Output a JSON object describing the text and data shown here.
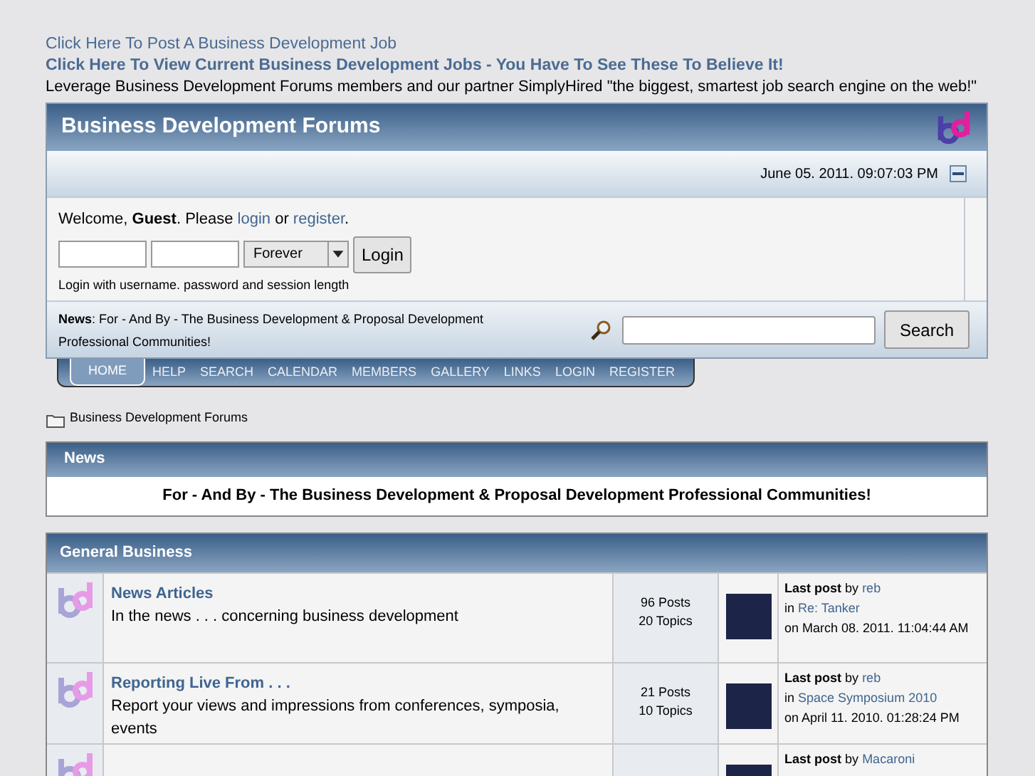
{
  "top_links": [
    {
      "text": "Click Here To Post A Business Development Job",
      "bold": false
    },
    {
      "text": "Click Here To View Current Business Development Jobs - You Have To See These To Believe It!",
      "bold": true
    }
  ],
  "tagline": "Leverage Business Development Forums members and our partner SimplyHired \"the biggest, smartest job search engine on the web!\"",
  "header": {
    "title": "Business Development Forums",
    "datetime": "June 05. 2011. 09:07:03 PM"
  },
  "welcome": {
    "prefix": "Welcome, **Guest**. Please",
    "login_link": "login",
    "middle": "or",
    "register_link": "register",
    "end": "."
  },
  "login": {
    "session": "Forever",
    "button": "Login",
    "hint": "Login with username. password and session length"
  },
  "news_bar": {
    "text": "**News**: For - And By - The Business Development & Proposal Development Professional Communities!",
    "search_button": "Search"
  },
  "nav": [
    {
      "label": "HOME",
      "selected": true
    },
    {
      "label": "HELP",
      "selected": false
    },
    {
      "label": "SEARCH",
      "selected": false
    },
    {
      "label": "CALENDAR",
      "selected": false
    },
    {
      "label": "MEMBERS",
      "selected": false
    },
    {
      "label": "GALLERY",
      "selected": false
    },
    {
      "label": "LINKS",
      "selected": false
    },
    {
      "label": "LOGIN",
      "selected": false
    },
    {
      "label": "REGISTER",
      "selected": false
    }
  ],
  "breadcrumb": "Business Development Forums",
  "news": {
    "title": "News",
    "text": "For - And By - The Business Development & Proposal Development Professional Communities!"
  },
  "category": {
    "title": "General Business",
    "boards": [
      {
        "name": "News Articles",
        "description": "In the news . . . concerning business development",
        "posts": "96 Posts",
        "topics": "20 Topics",
        "last_post": {
          "label": "Last post",
          "by": "by",
          "author": "reb",
          "in": "in",
          "topic": "Re: Tanker",
          "on": "on March 08. 2011. 11:04:44 AM"
        }
      },
      {
        "name": "Reporting Live From . . .",
        "description": "Report your views and impressions from conferences, symposia, events",
        "posts": "21 Posts",
        "topics": "10 Topics",
        "last_post": {
          "label": "Last post",
          "by": "by",
          "author": "reb",
          "in": "in",
          "topic": "Space Symposium 2010",
          "on": "on April 11. 2010. 01:28:24 PM"
        }
      },
      {
        "last_post": {
          "label": "Last post",
          "by": "by",
          "author": "Macaroni"
        }
      }
    ]
  }
}
